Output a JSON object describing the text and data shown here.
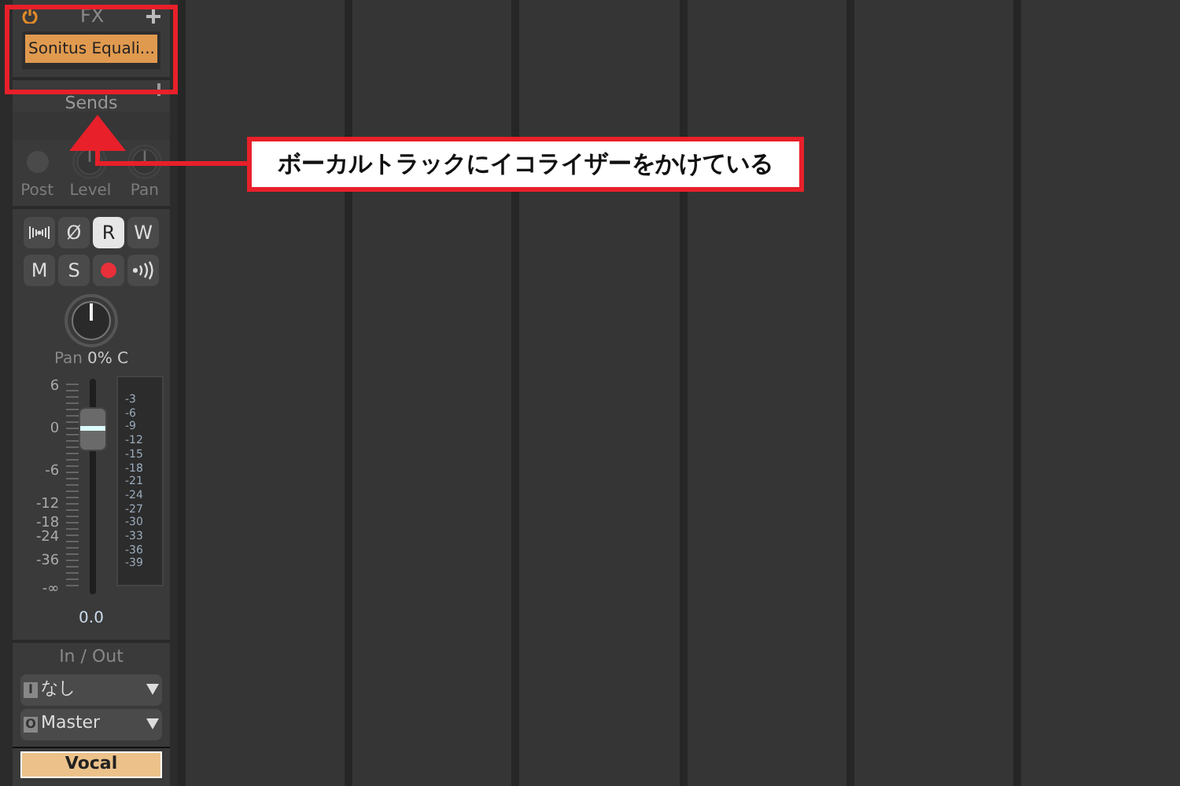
{
  "strip": {
    "fx": {
      "title": "FX",
      "plugins": [
        {
          "name": "Sonitus Equali..."
        }
      ]
    },
    "sends": {
      "title": "Sends",
      "disabled": true,
      "controls": [
        {
          "kind": "dot",
          "label": "Post"
        },
        {
          "kind": "knob",
          "label": "Level"
        },
        {
          "kind": "knob",
          "label": "Pan"
        }
      ]
    },
    "buttons": [
      {
        "kind": "meter",
        "selected": false
      },
      {
        "kind": "text",
        "label": "Ø",
        "selected": false
      },
      {
        "kind": "text",
        "label": "R",
        "selected": true
      },
      {
        "kind": "text",
        "label": "W",
        "selected": false
      },
      {
        "kind": "text",
        "label": "M",
        "selected": false
      },
      {
        "kind": "text",
        "label": "S",
        "selected": false
      },
      {
        "kind": "record",
        "selected": false
      },
      {
        "kind": "echo",
        "selected": false
      }
    ],
    "pan": {
      "label": "Pan",
      "value": "0% C"
    },
    "fader": {
      "scale": [
        "6",
        "0",
        "-6",
        "-12",
        "-18",
        "-24",
        "-36",
        "-∞"
      ],
      "meter_scale": [
        "-3",
        "-6",
        "-9",
        "-12",
        "-15",
        "-18",
        "-21",
        "-24",
        "-27",
        "-30",
        "-33",
        "-36",
        "-39"
      ],
      "reading": "0.0"
    },
    "io": {
      "title": "In / Out",
      "input": {
        "badge": "I",
        "value": "なし"
      },
      "output": {
        "badge": "O",
        "value": "Master"
      }
    },
    "name": "Vocal"
  },
  "annotation": {
    "text": "ボーカルトラックにイコライザーをかけている"
  }
}
